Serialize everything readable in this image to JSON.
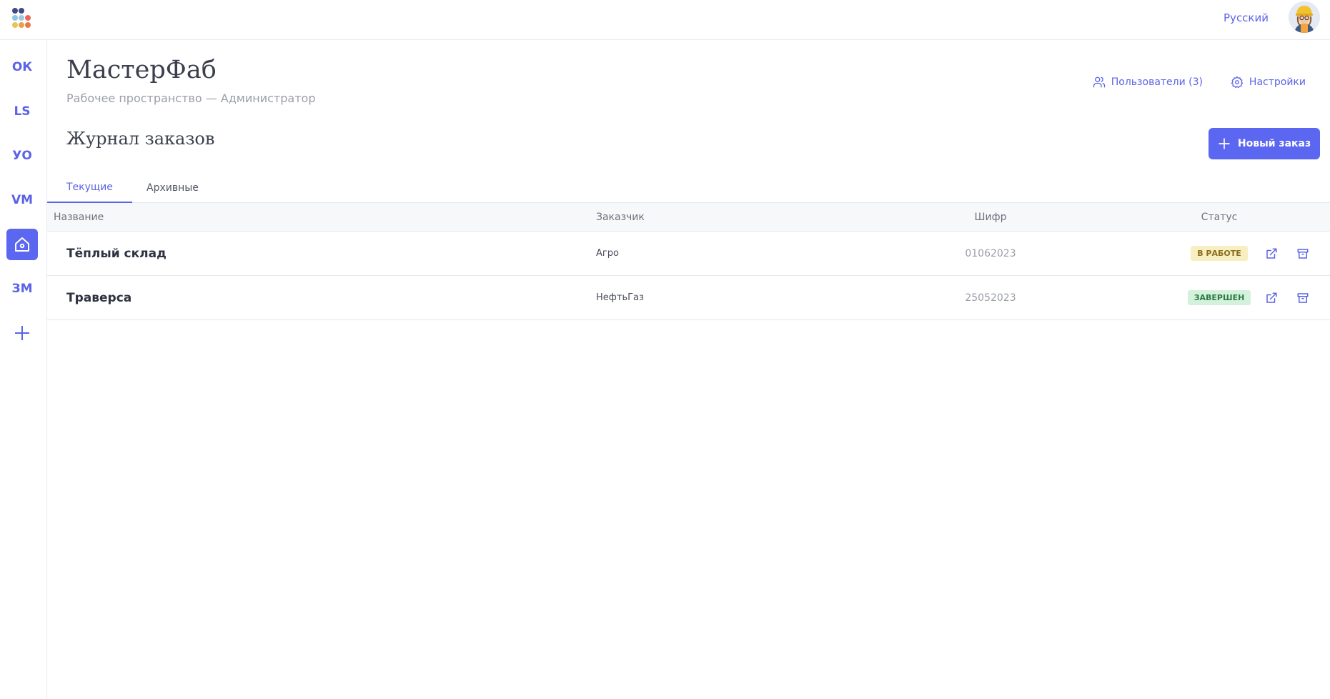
{
  "header": {
    "language": "Русский",
    "logo_colors": [
      "#3f4a86",
      "#3f4a86",
      "#6fb1d8",
      "#9ec7e0",
      "#e9685a",
      "#e8c25a",
      "#e8a04a",
      "#e87a4a"
    ]
  },
  "sidebar": {
    "items": [
      {
        "label": "ОК"
      },
      {
        "label": "LS"
      },
      {
        "label": "УО"
      },
      {
        "label": "VM"
      },
      {
        "label": "",
        "icon": "home-icon",
        "active": true
      },
      {
        "label": "ЗМ"
      },
      {
        "label": "",
        "icon": "plus-icon"
      }
    ]
  },
  "workspace": {
    "title": "МастерФаб",
    "subtitle": "Рабочее пространство — Администратор",
    "users_link": "Пользователи (3)",
    "settings_link": "Настройки"
  },
  "orders": {
    "title": "Журнал заказов",
    "new_button": "Новый заказ",
    "tabs": [
      {
        "label": "Текущие",
        "active": true
      },
      {
        "label": "Архивные",
        "active": false
      }
    ],
    "columns": {
      "name": "Название",
      "customer": "Заказчик",
      "code": "Шифр",
      "status": "Статус"
    },
    "rows": [
      {
        "name": "Тёплый склад",
        "customer": "Агро",
        "code": "01062023",
        "status": "В РАБОТЕ",
        "status_bg": "#f7efc2",
        "status_fg": "#8a6d1a"
      },
      {
        "name": "Траверса",
        "customer": "НефтьГаз",
        "code": "25052023",
        "status": "ЗАВЕРШЕН",
        "status_bg": "#d4f1dc",
        "status_fg": "#2d7a45"
      }
    ]
  },
  "colors": {
    "accent": "#5b67f0"
  }
}
